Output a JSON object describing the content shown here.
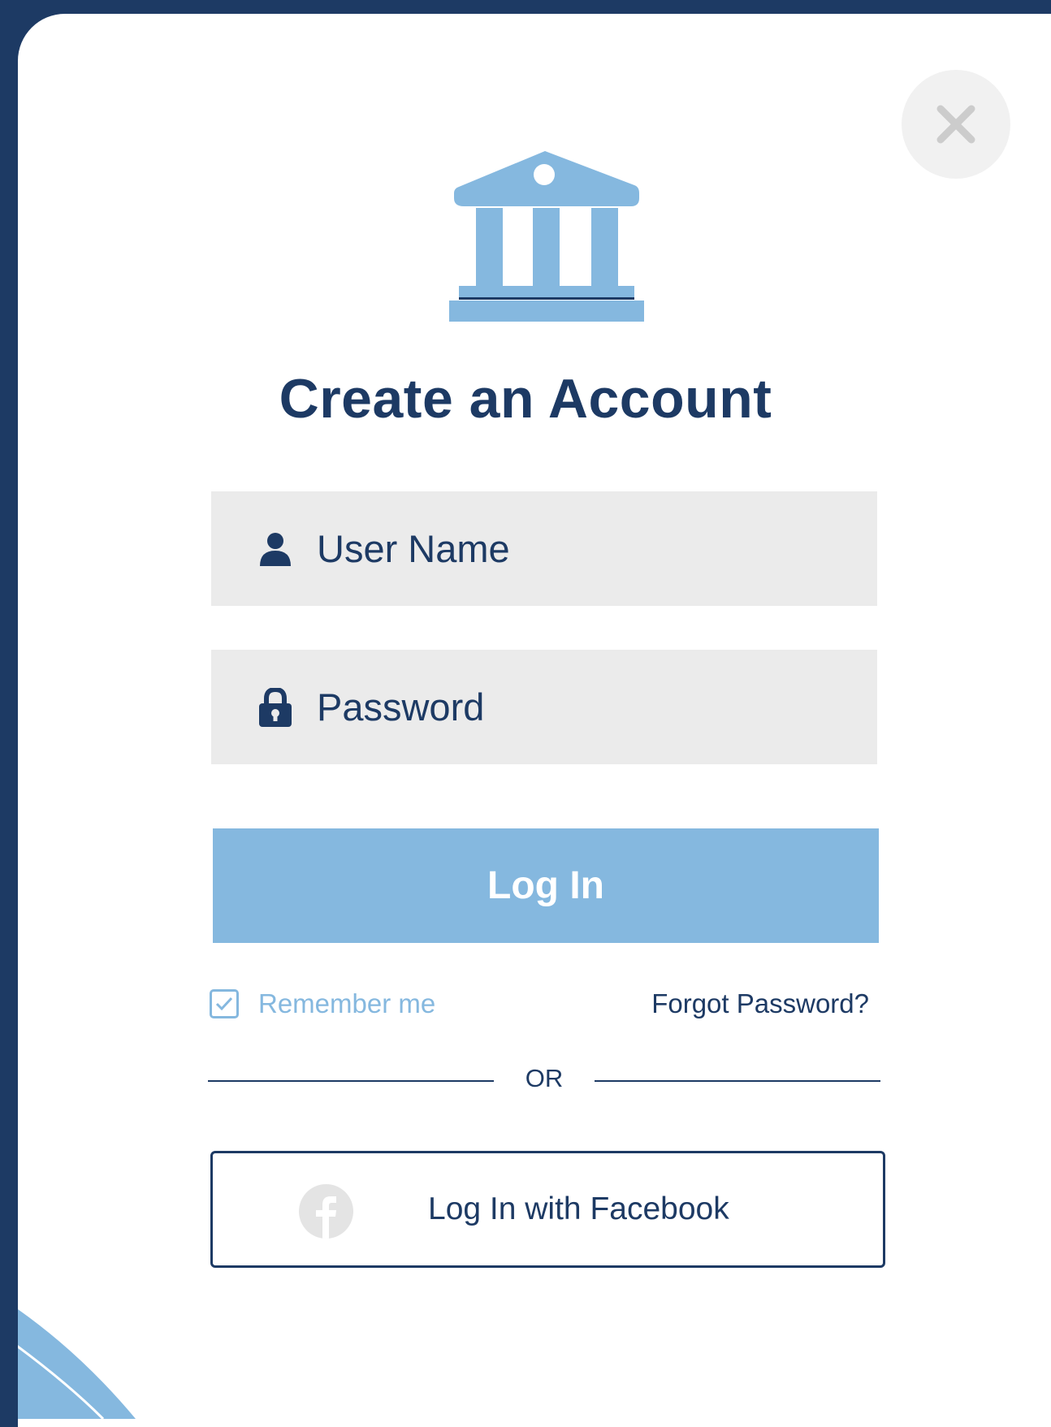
{
  "app": {
    "title": "Create an Account"
  },
  "form": {
    "username_placeholder": "User Name",
    "password_placeholder": "Password",
    "login_label": "Log In",
    "remember_label": "Remember me",
    "remember_checked": true,
    "forgot_label": "Forgot Password?",
    "divider_label": "OR",
    "facebook_label": "Log In with Facebook"
  },
  "icons": {
    "logo": "bank-icon",
    "close": "close-icon",
    "user": "user-icon",
    "password": "lock-icon",
    "checkbox": "check-icon",
    "facebook": "facebook-icon"
  },
  "colors": {
    "primary": "#1d3a64",
    "accent": "#85b8df",
    "field_bg": "#ebebeb",
    "icon_gray": "#e4e4e4",
    "background": "#ffffff"
  }
}
